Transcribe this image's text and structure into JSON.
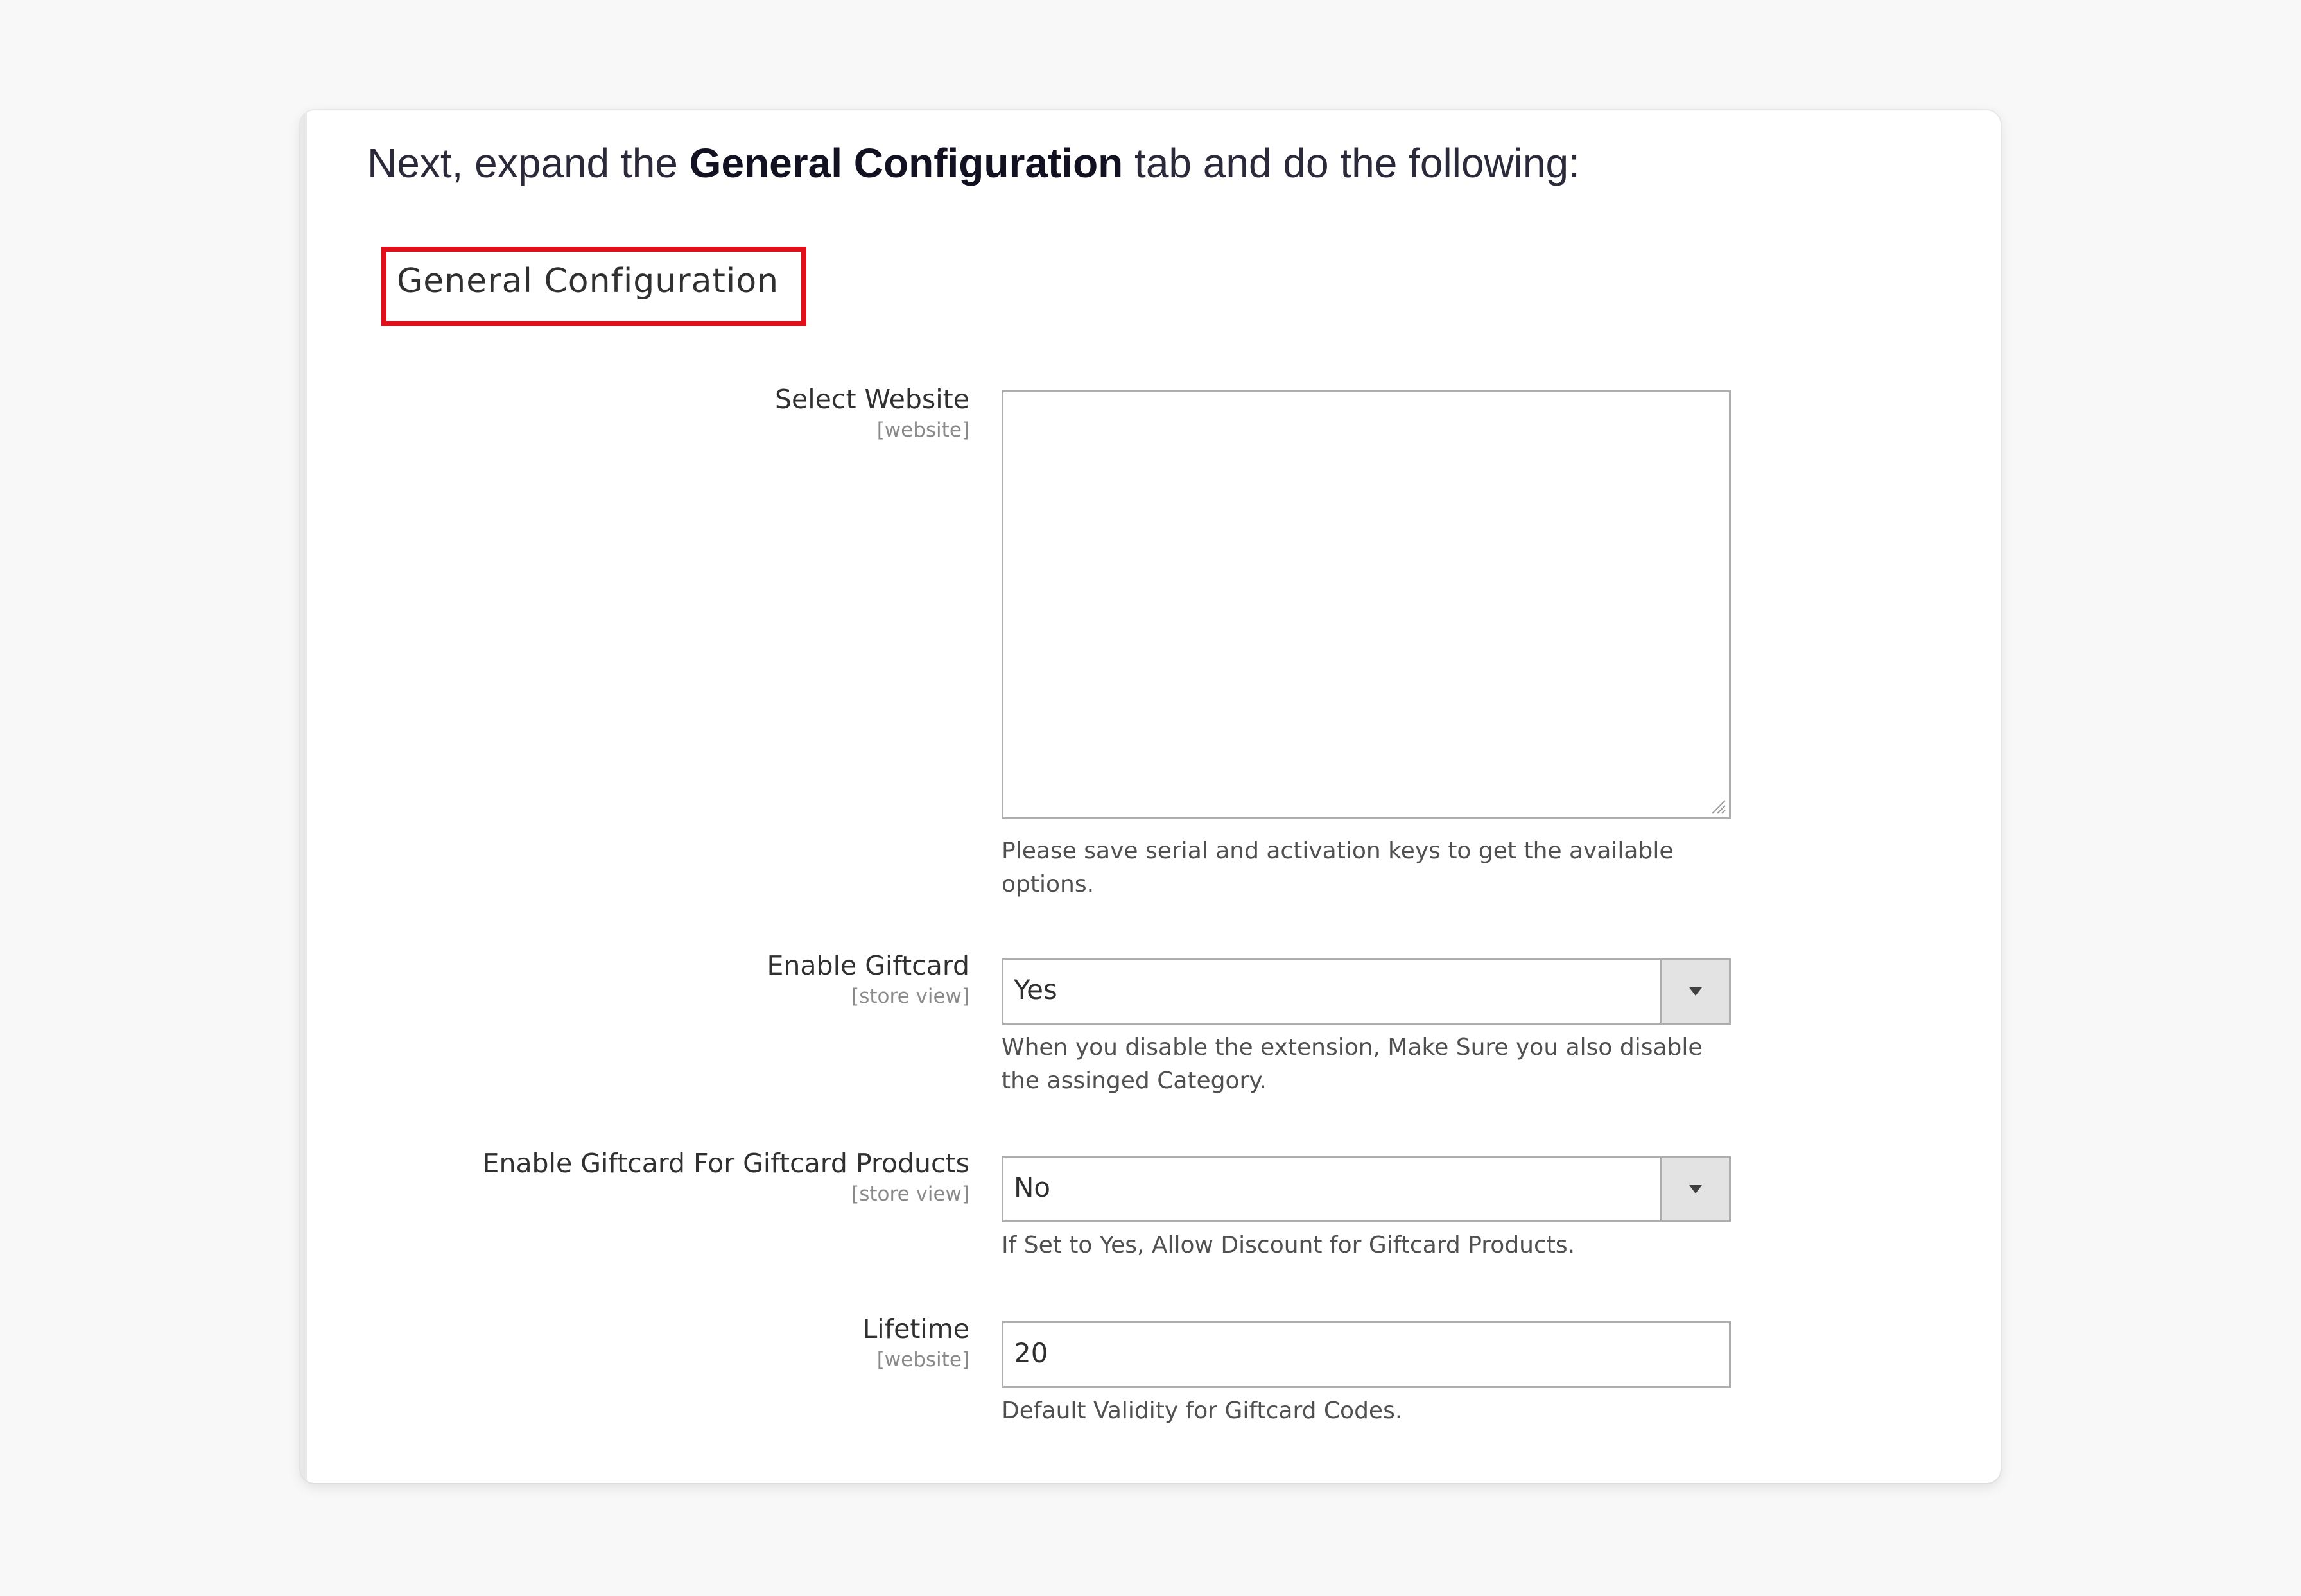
{
  "intro": {
    "prefix": "Next, expand the ",
    "emphasis": "General Configuration",
    "suffix": " tab and do the following:"
  },
  "section": {
    "title": "General Configuration",
    "highlight_color": "#e0101a"
  },
  "fields": {
    "select_website": {
      "label": "Select Website",
      "scope": "[website]",
      "value": "",
      "help": "Please save serial and activation keys to get the available options."
    },
    "enable_giftcard": {
      "label": "Enable Giftcard",
      "scope": "[store view]",
      "value": "Yes",
      "help": "When you disable the extension, Make Sure you also disable the assinged Category."
    },
    "enable_giftcard_products": {
      "label": "Enable Giftcard For Giftcard Products",
      "scope": "[store view]",
      "value": "No",
      "help": "If Set to Yes, Allow Discount for Giftcard Products."
    },
    "lifetime": {
      "label": "Lifetime",
      "scope": "[website]",
      "value": "20",
      "help": "Default Validity for Giftcard Codes."
    }
  },
  "icons": {
    "dropdown": "chevron-down-icon",
    "resize": "resize-handle-icon"
  }
}
